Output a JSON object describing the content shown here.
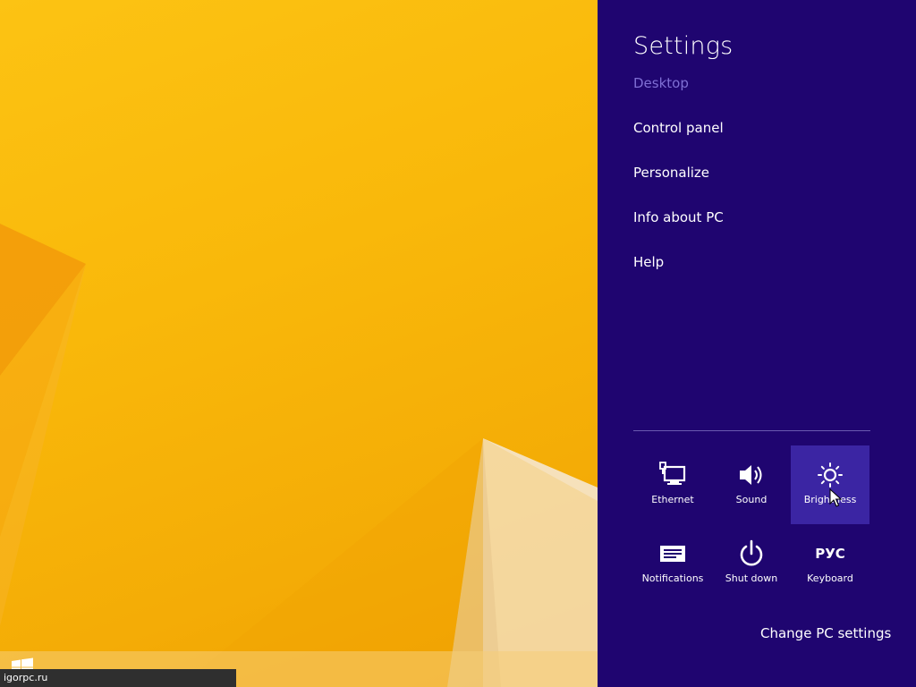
{
  "charm": {
    "title": "Settings",
    "subtitle": "Desktop",
    "menu": [
      {
        "label": "Control panel"
      },
      {
        "label": "Personalize"
      },
      {
        "label": "Info about PC"
      },
      {
        "label": "Help"
      }
    ],
    "quick_settings": [
      {
        "label": "Ethernet",
        "icon": "ethernet-icon"
      },
      {
        "label": "Sound",
        "icon": "speaker-icon"
      },
      {
        "label": "Brightness",
        "icon": "brightness-icon",
        "active": true
      },
      {
        "label": "Notifications",
        "icon": "notifications-icon"
      },
      {
        "label": "Shut down",
        "icon": "power-icon"
      },
      {
        "label": "Keyboard",
        "icon_text": "РУС"
      }
    ],
    "change_settings": "Change PC settings"
  },
  "taskbar": {
    "watermark": "igorpc.ru"
  },
  "colors": {
    "charm_background": "#1f0570",
    "tile_active": "#3b25a3",
    "subtitle": "#7f6fd4",
    "wallpaper": "#f9b80a"
  }
}
